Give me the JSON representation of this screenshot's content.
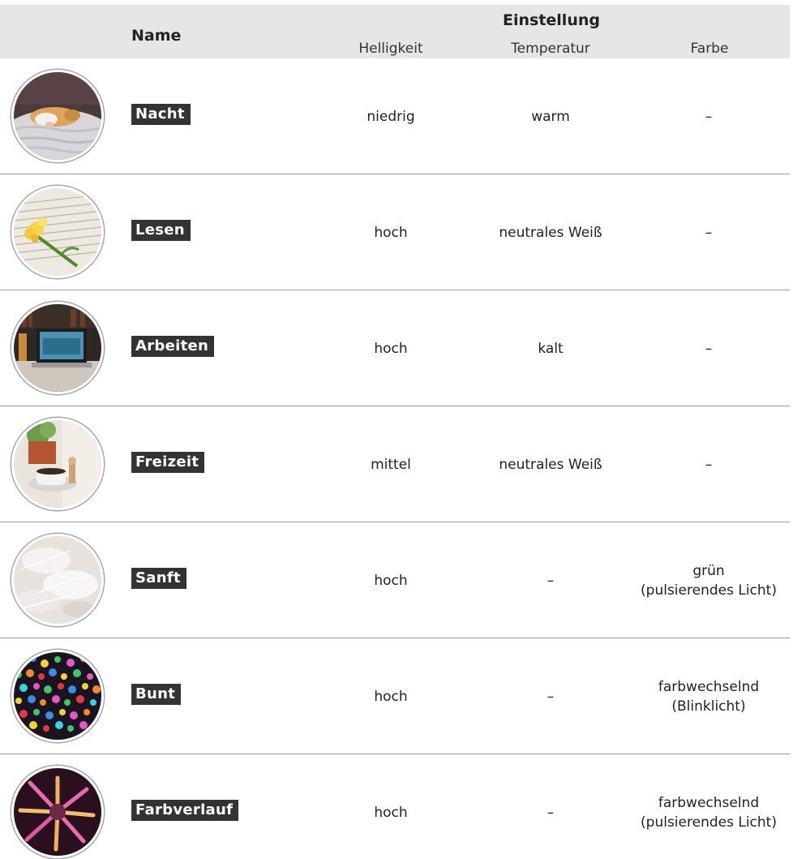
{
  "header": {
    "name": "Name",
    "einstellung": "Einstellung",
    "helligkeit": "Helligkeit",
    "temperatur": "Temperatur",
    "farbe": "Farbe"
  },
  "rows": [
    {
      "name": "Nacht",
      "helligkeit": "niedrig",
      "temperatur": "warm",
      "farbe_line1": "–",
      "farbe_line2": "",
      "image": "sleeping-cat-photo"
    },
    {
      "name": "Lesen",
      "helligkeit": "hoch",
      "temperatur": "neutrales Weiß",
      "farbe_line1": "–",
      "farbe_line2": "",
      "image": "flower-on-book-photo"
    },
    {
      "name": "Arbeiten",
      "helligkeit": "hoch",
      "temperatur": "kalt",
      "farbe_line1": "–",
      "farbe_line2": "",
      "image": "laptop-desk-photo"
    },
    {
      "name": "Freizeit",
      "helligkeit": "mittel",
      "temperatur": "neutrales Weiß",
      "farbe_line1": "–",
      "farbe_line2": "",
      "image": "coffee-cup-plant-photo"
    },
    {
      "name": "Sanft",
      "helligkeit": "hoch",
      "temperatur": "–",
      "farbe_line1": "grün",
      "farbe_line2": "(pulsierendes Licht)",
      "image": "white-feathers-photo"
    },
    {
      "name": "Bunt",
      "helligkeit": "hoch",
      "temperatur": "–",
      "farbe_line1": "farbwechselnd",
      "farbe_line2": "(Blinklicht)",
      "image": "colorful-bokeh-photo"
    },
    {
      "name": "Farbverlauf",
      "helligkeit": "hoch",
      "temperatur": "–",
      "farbe_line1": "farbwechselnd",
      "farbe_line2": "(pulsierendes Licht)",
      "image": "fireworks-photo"
    }
  ],
  "colors": {
    "header_bg": "#e6e6e6",
    "badge_bg": "#333333",
    "badge_text": "#ffffff",
    "separator": "#9a9a9a"
  }
}
